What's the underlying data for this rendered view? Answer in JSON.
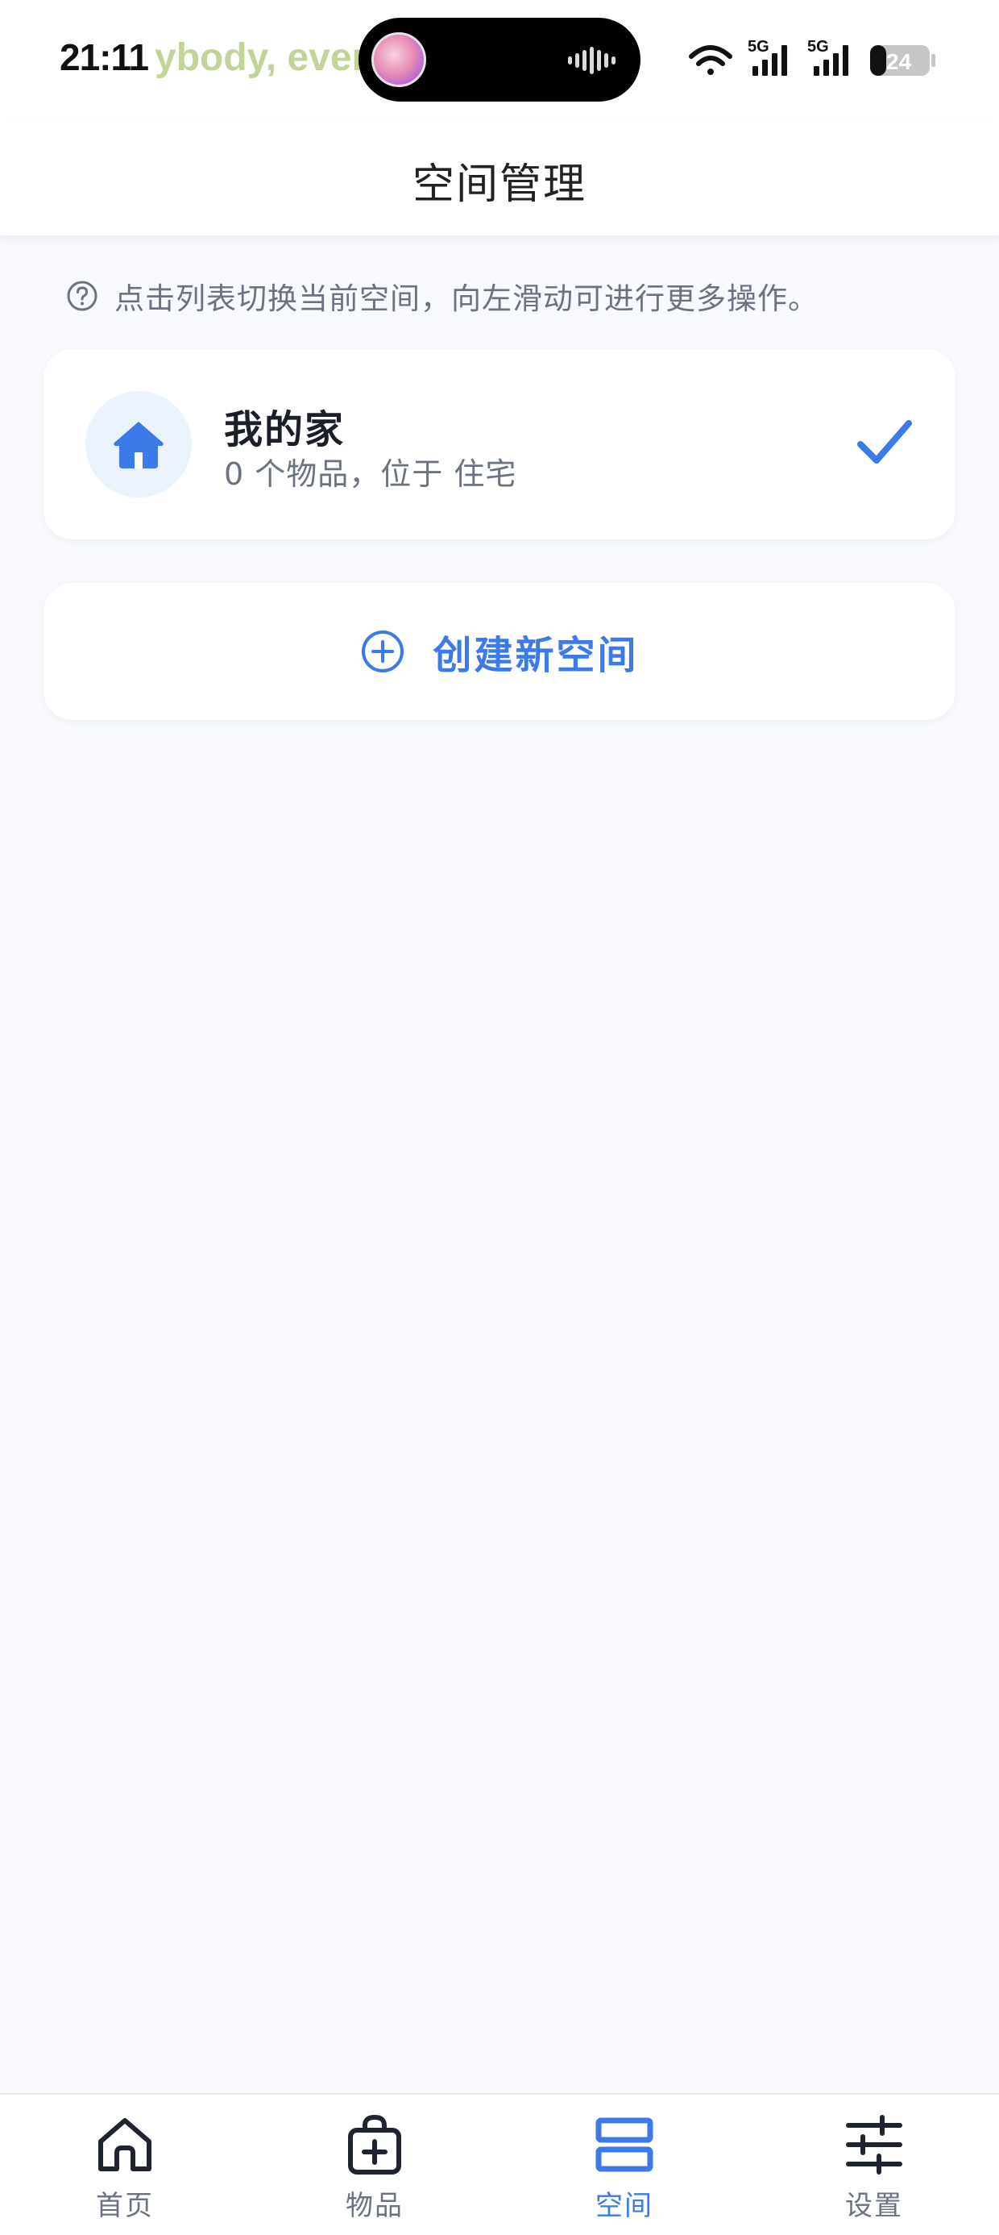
{
  "status_bar": {
    "time": "21:11",
    "marquee_text": "ybody, ever",
    "battery_level": "24",
    "network_1": "5G",
    "network_2": "5G"
  },
  "header": {
    "title": "空间管理"
  },
  "hint": {
    "text": "点击列表切换当前空间，向左滑动可进行更多操作。"
  },
  "spaces": [
    {
      "name": "我的家",
      "meta": "0 个物品，位于 住宅",
      "selected": true,
      "icon": "house-icon"
    }
  ],
  "create_space": {
    "label": "创建新空间",
    "icon": "plus-circle-icon"
  },
  "tab_bar": {
    "tabs": [
      {
        "label": "首页",
        "icon": "home-icon",
        "active": false
      },
      {
        "label": "物品",
        "icon": "bag-plus-icon",
        "active": false
      },
      {
        "label": "空间",
        "icon": "stacked-boxes-icon",
        "active": true
      },
      {
        "label": "设置",
        "icon": "sliders-icon",
        "active": false
      }
    ]
  },
  "colors": {
    "accent": "#3b7ae8",
    "background": "#f7f9fc",
    "card": "#ffffff",
    "muted_text": "#6b7280"
  }
}
